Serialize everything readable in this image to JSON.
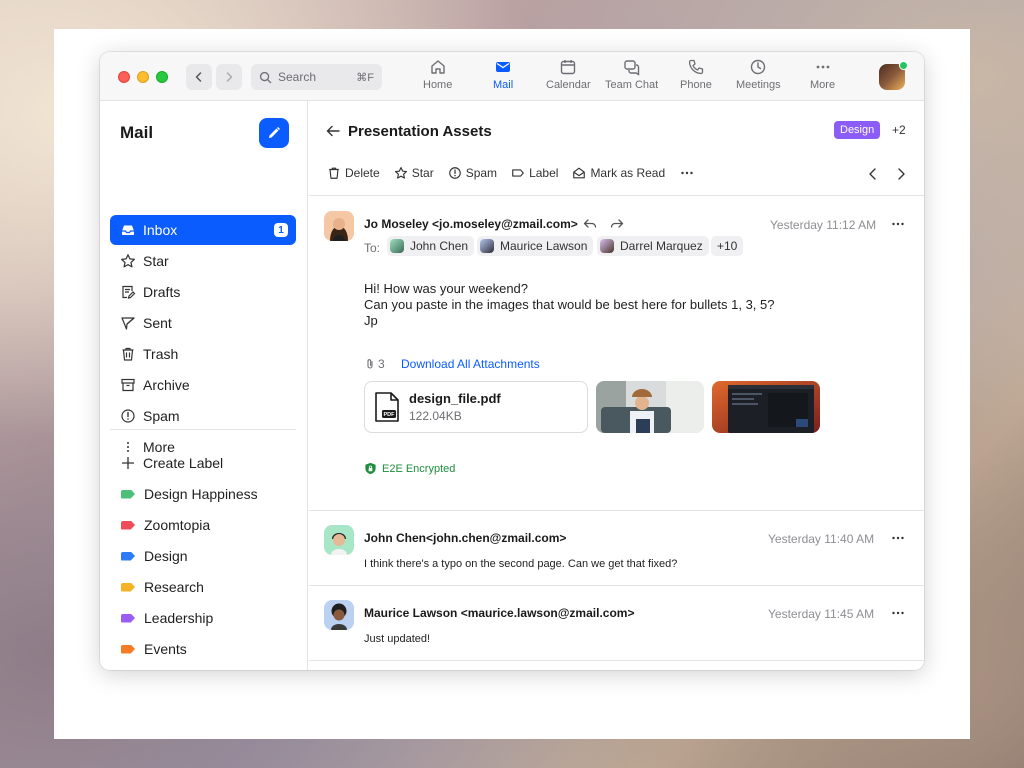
{
  "titlebar": {
    "search_placeholder": "Search",
    "search_shortcut": "⌘F",
    "tabs": [
      {
        "label": "Home",
        "icon": "home-icon"
      },
      {
        "label": "Mail",
        "icon": "mail-icon",
        "active": true
      },
      {
        "label": "Calendar",
        "icon": "calendar-icon"
      },
      {
        "label": "Team Chat",
        "icon": "chat-icon"
      },
      {
        "label": "Phone",
        "icon": "phone-icon"
      },
      {
        "label": "Meetings",
        "icon": "clock-icon"
      },
      {
        "label": "More",
        "icon": "more-icon"
      }
    ]
  },
  "sidebar": {
    "title": "Mail",
    "items": [
      {
        "label": "Inbox",
        "icon": "inbox-icon",
        "badge": "1",
        "active": true
      },
      {
        "label": "Star",
        "icon": "star-icon"
      },
      {
        "label": "Drafts",
        "icon": "drafts-icon"
      },
      {
        "label": "Sent",
        "icon": "sent-icon"
      },
      {
        "label": "Trash",
        "icon": "trash-icon"
      },
      {
        "label": "Archive",
        "icon": "archive-icon"
      },
      {
        "label": "Spam",
        "icon": "spam-icon"
      },
      {
        "label": "More",
        "icon": "more-vertical-icon"
      }
    ],
    "create_label": "Create Label",
    "labels": [
      {
        "label": "Design Happiness",
        "color": "#4cc07a"
      },
      {
        "label": "Zoomtopia",
        "color": "#ef4c5a"
      },
      {
        "label": "Design",
        "color": "#2d7cf6"
      },
      {
        "label": "Research",
        "color": "#f5b325"
      },
      {
        "label": "Leadership",
        "color": "#9b5cf2"
      },
      {
        "label": "Events",
        "color": "#f57c25"
      }
    ]
  },
  "thread": {
    "subject": "Presentation Assets",
    "tag": "Design",
    "tag_color": "#8b5cf6",
    "tag_more": "+2",
    "toolbar": [
      "Delete",
      "Star",
      "Spam",
      "Label",
      "Mark as Read"
    ],
    "messages": [
      {
        "sender": "Jo Moseley <jo.moseley@zmail.com>",
        "time": "Yesterday 11:12 AM",
        "to_label": "To:",
        "recipients": [
          "John Chen",
          "Maurice Lawson",
          "Darrel Marquez"
        ],
        "recipients_more": "+10",
        "body": [
          "Hi! How was your weekend?",
          "Can you paste in the images that would be best here for bullets 1, 3, 5?",
          "Jp"
        ],
        "attachment_count": "3",
        "download_all": "Download All Attachments",
        "file_name": "design_file.pdf",
        "file_size": "122.04KB",
        "file_badge": "PDF",
        "encryption": "E2E Encrypted"
      },
      {
        "sender": "John Chen<john.chen@zmail.com>",
        "time": "Yesterday 11:40 AM",
        "body": "I think there's a typo on the second page. Can we get that fixed?"
      },
      {
        "sender": "Maurice Lawson <maurice.lawson@zmail.com>",
        "time": "Yesterday 11:45 AM",
        "body": "Just updated!"
      }
    ]
  },
  "colors": {
    "accent": "#0b5cff",
    "encrypted": "#1e8e3e"
  }
}
